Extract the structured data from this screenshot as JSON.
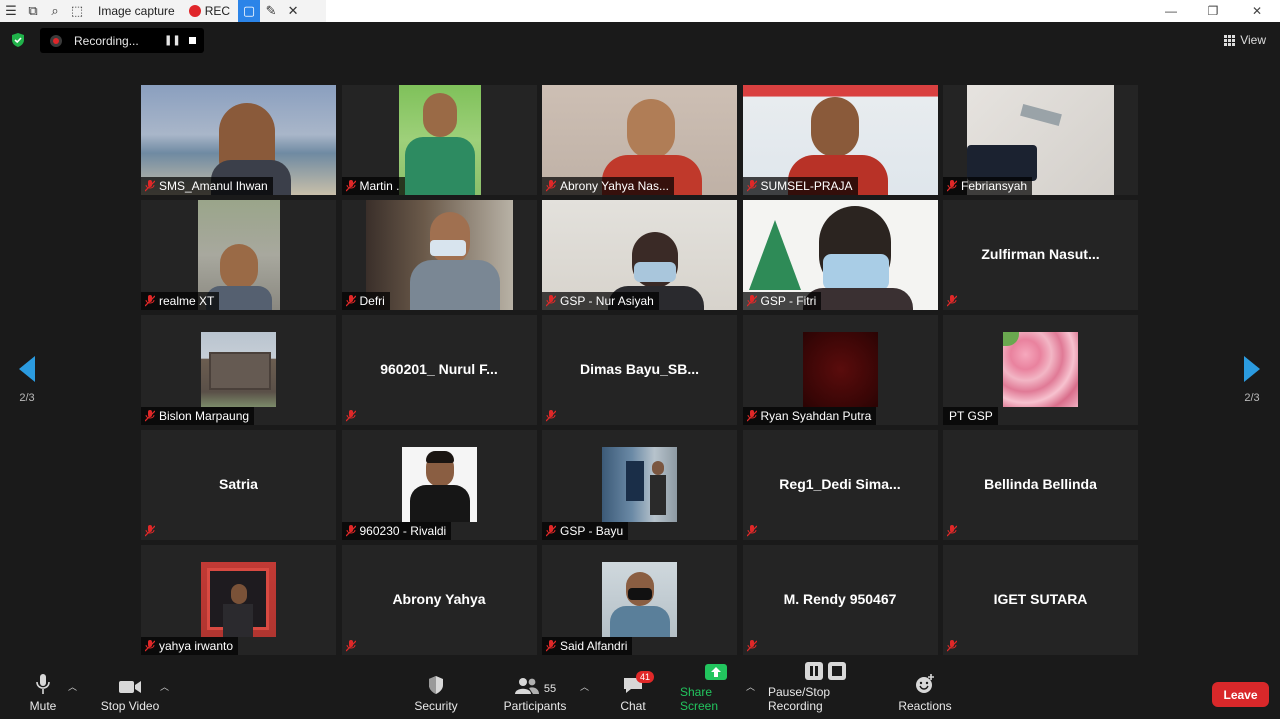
{
  "capture_toolbar": {
    "title": "Image capture",
    "rec_label": "REC"
  },
  "recording": {
    "status": "Recording..."
  },
  "view_button": {
    "label": "View"
  },
  "pager": {
    "left": "2/3",
    "right": "2/3"
  },
  "participants": [
    {
      "name": "SMS_Amanul Ihwan"
    },
    {
      "name": "Martin ."
    },
    {
      "name": "Abrony Yahya Nas..."
    },
    {
      "name": "SUMSEL-PRAJA"
    },
    {
      "name": "Febriansyah"
    },
    {
      "name": "realme XT"
    },
    {
      "name": "Defri"
    },
    {
      "name": "GSP - Nur Asiyah"
    },
    {
      "name": "GSP - Fitri"
    },
    {
      "name": "",
      "display": "Zulfirman  Nasut..."
    },
    {
      "name": "Bislon Marpaung"
    },
    {
      "name": "",
      "display": "960201_ Nurul F..."
    },
    {
      "name": "",
      "display": "Dimas  Bayu_SB..."
    },
    {
      "name": "Ryan Syahdan Putra"
    },
    {
      "name": "PT GSP"
    },
    {
      "name": "",
      "display": "Satria"
    },
    {
      "name": "960230 - Rivaldi"
    },
    {
      "name": "GSP - Bayu"
    },
    {
      "name": "",
      "display": "Reg1_Dedi  Sima..."
    },
    {
      "name": "",
      "display": "Bellinda Bellinda"
    },
    {
      "name": "yahya irwanto"
    },
    {
      "name": "",
      "display": "Abrony Yahya"
    },
    {
      "name": "Said Alfandri"
    },
    {
      "name": "",
      "display": "M. Rendy 950467"
    },
    {
      "name": "",
      "display": "IGET SUTARA"
    }
  ],
  "toolbar": {
    "mute": "Mute",
    "stop_video": "Stop Video",
    "security": "Security",
    "participants": "Participants",
    "participants_count": "55",
    "chat": "Chat",
    "chat_badge": "41",
    "share_screen": "Share Screen",
    "recording": "Pause/Stop Recording",
    "reactions": "Reactions",
    "leave": "Leave"
  },
  "colors": {
    "accent_blue": "#2b9be0",
    "share_green": "#22c55e",
    "leave_red": "#d9282a",
    "muted_red": "#e02828"
  }
}
